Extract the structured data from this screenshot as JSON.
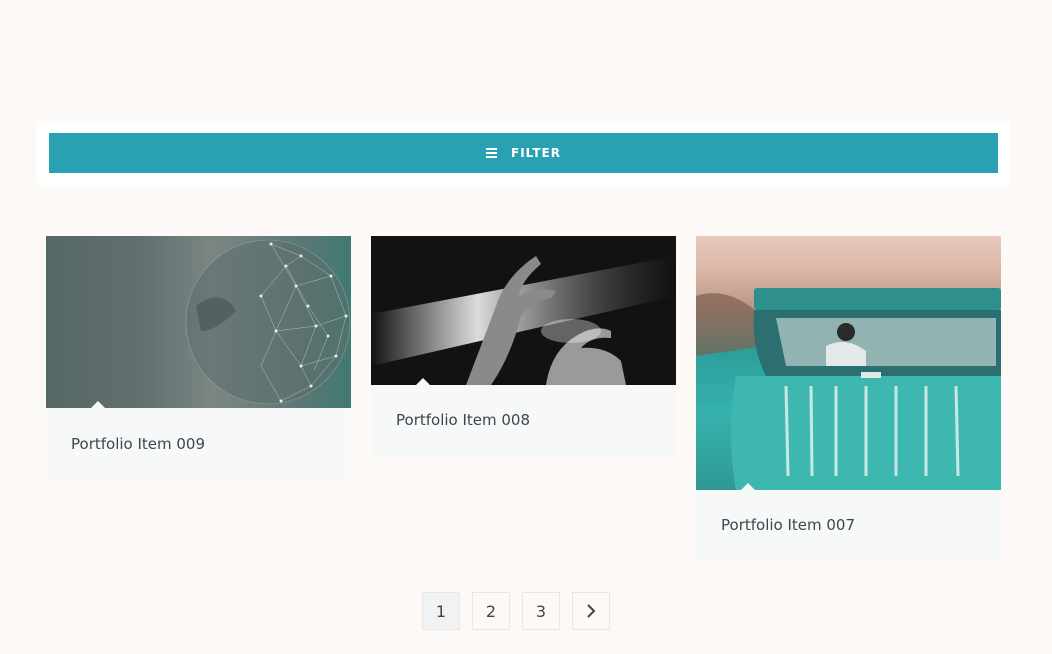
{
  "filter": {
    "label": "FILTER",
    "icon": "hamburger-icon",
    "color": "#2aa0b3"
  },
  "portfolio": [
    {
      "title": "Portfolio Item 009",
      "image": "globe-network-image"
    },
    {
      "title": "Portfolio Item 008",
      "image": "hands-light-image"
    },
    {
      "title": "Portfolio Item 007",
      "image": "teal-car-image"
    }
  ],
  "pagination": {
    "pages": [
      "1",
      "2",
      "3"
    ],
    "current": "1",
    "next_icon": "chevron-right-icon"
  }
}
